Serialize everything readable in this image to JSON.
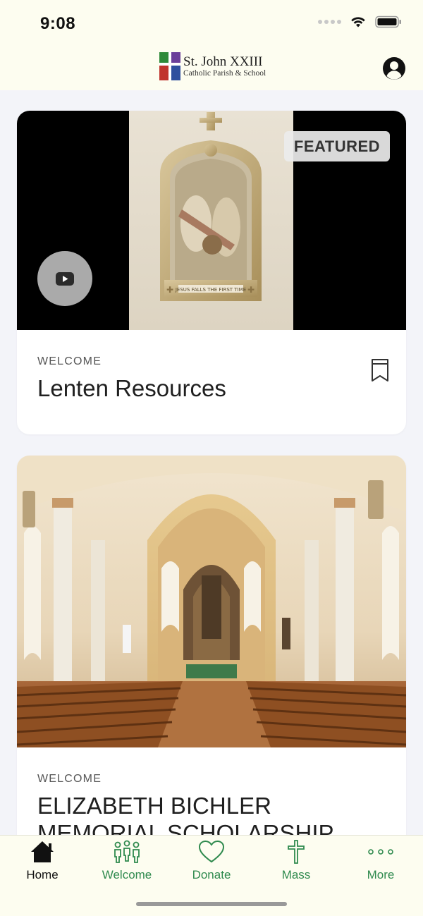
{
  "status_bar": {
    "time": "9:08"
  },
  "header": {
    "logo_line1": "St. John XXIII",
    "logo_line2": "Catholic Parish & School"
  },
  "feed": [
    {
      "badge": "FEATURED",
      "plaque_caption": "JESUS FALLS THE FIRST TIME",
      "category": "WELCOME",
      "title": "Lenten Resources"
    },
    {
      "category": "WELCOME",
      "title": "ELIZABETH BICHLER MEMORIAL SCHOLARSHIP"
    }
  ],
  "tabs": [
    {
      "label": "Home",
      "icon": "home-icon",
      "active": true
    },
    {
      "label": "Welcome",
      "icon": "people-icon",
      "active": false
    },
    {
      "label": "Donate",
      "icon": "heart-icon",
      "active": false
    },
    {
      "label": "Mass",
      "icon": "cross-icon",
      "active": false
    },
    {
      "label": "More",
      "icon": "more-dots-icon",
      "active": false
    }
  ],
  "colors": {
    "accent_green": "#2f8a4e",
    "header_bg": "#fdfdf0",
    "page_bg": "#f3f4f9"
  }
}
